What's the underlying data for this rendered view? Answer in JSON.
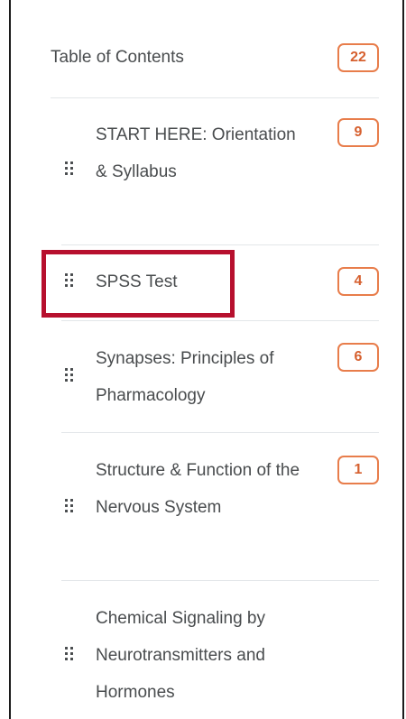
{
  "toc": {
    "title": "Table of Contents",
    "count": "22"
  },
  "modules": [
    {
      "label": "START HERE: Orientation & Syllabus",
      "count": "9"
    },
    {
      "label": "SPSS Test",
      "count": "4",
      "highlighted": true
    },
    {
      "label": "Synapses: Principles of Pharmacology",
      "count": "6"
    },
    {
      "label": "Structure & Function of the Nervous System",
      "count": "1"
    },
    {
      "label": "Chemical Signaling by Neurotransmitters and Hormones",
      "count": ""
    }
  ],
  "icons": {
    "drag_handle": "grip-dots-icon"
  },
  "colors": {
    "badge_border": "#e87d4b",
    "badge_text": "#d6602f",
    "highlight": "#b7102e",
    "text": "#494c4e",
    "divider": "#e3e6e9"
  }
}
